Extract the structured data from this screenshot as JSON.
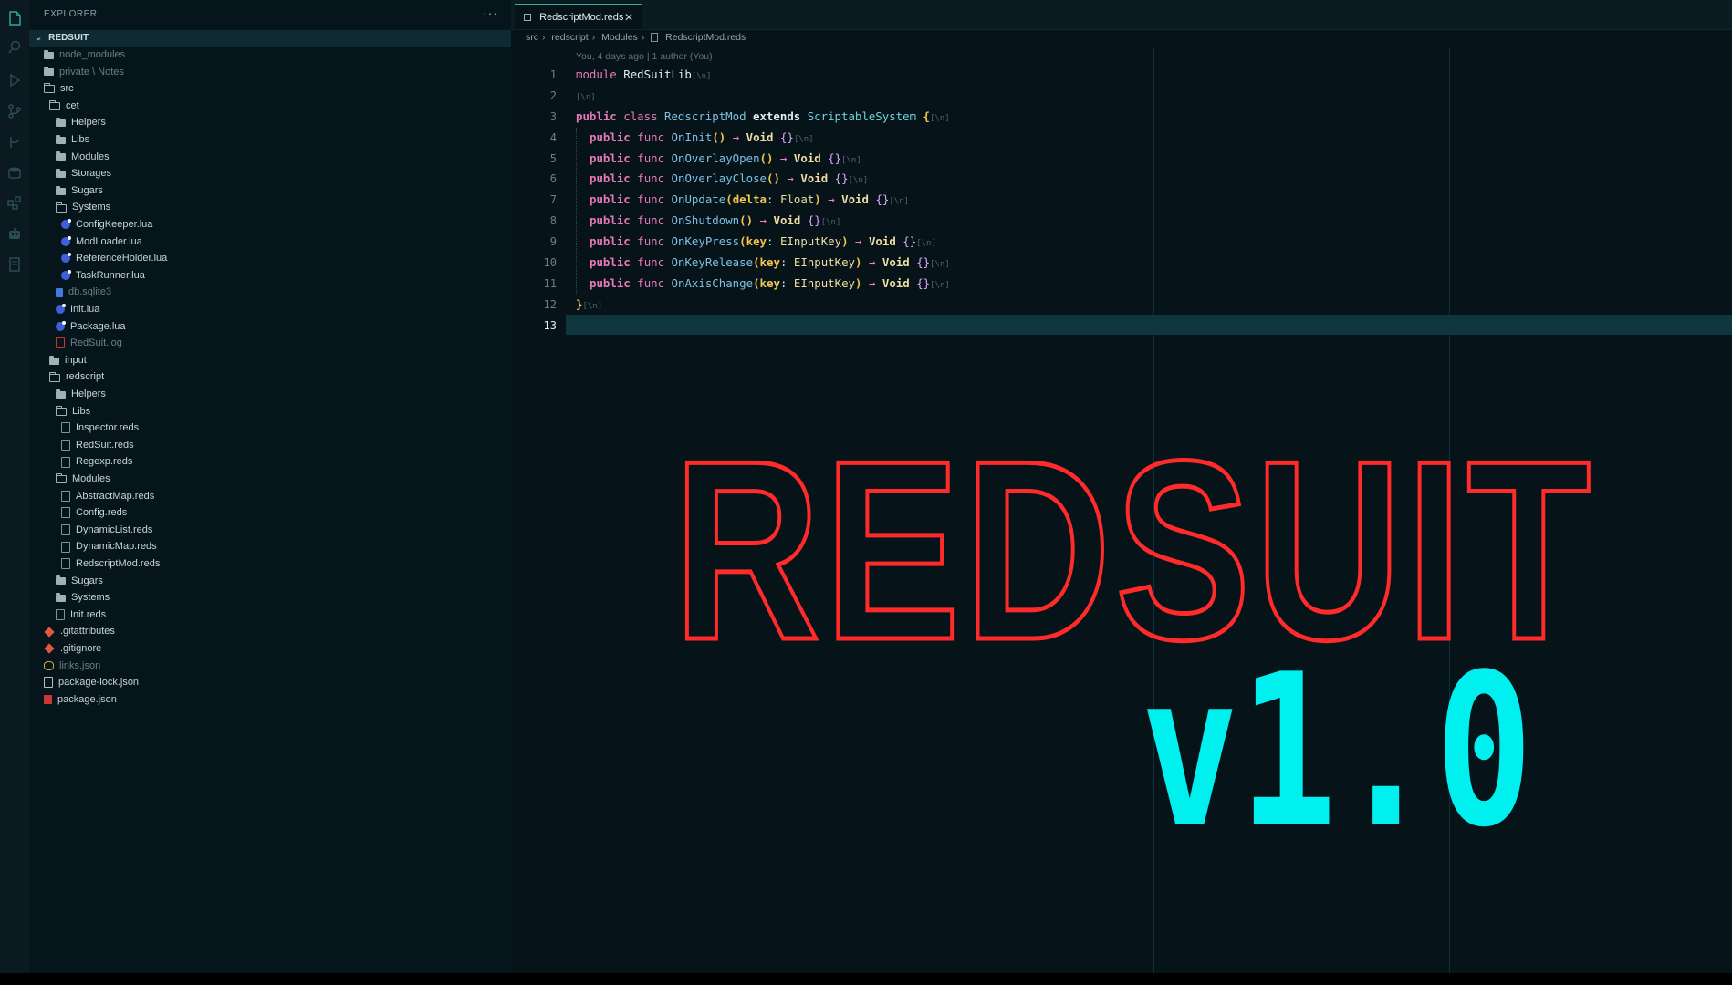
{
  "explorer": {
    "title": "EXPLORER",
    "more": "···",
    "project": "REDSUIT"
  },
  "tree": [
    {
      "label": "node_modules",
      "icon": "folder-closed",
      "depth": 0,
      "dim": true
    },
    {
      "label": "private \\ Notes",
      "icon": "folder-closed",
      "depth": 0,
      "dim": true
    },
    {
      "label": "src",
      "icon": "folder",
      "depth": 0
    },
    {
      "label": "cet",
      "icon": "folder",
      "depth": 1
    },
    {
      "label": "Helpers",
      "icon": "folder-closed",
      "depth": 2
    },
    {
      "label": "Libs",
      "icon": "folder-closed",
      "depth": 2
    },
    {
      "label": "Modules",
      "icon": "folder-closed",
      "depth": 2
    },
    {
      "label": "Storages",
      "icon": "folder-closed",
      "depth": 2
    },
    {
      "label": "Sugars",
      "icon": "folder-closed",
      "depth": 2
    },
    {
      "label": "Systems",
      "icon": "folder",
      "depth": 2
    },
    {
      "label": "ConfigKeeper.lua",
      "icon": "lua",
      "depth": 3
    },
    {
      "label": "ModLoader.lua",
      "icon": "lua",
      "depth": 3
    },
    {
      "label": "ReferenceHolder.lua",
      "icon": "lua",
      "depth": 3
    },
    {
      "label": "TaskRunner.lua",
      "icon": "lua",
      "depth": 3
    },
    {
      "label": "db.sqlite3",
      "icon": "db",
      "depth": 2,
      "dim": true
    },
    {
      "label": "Init.lua",
      "icon": "lua",
      "depth": 2
    },
    {
      "label": "Package.lua",
      "icon": "lua",
      "depth": 2
    },
    {
      "label": "RedSuit.log",
      "icon": "log",
      "depth": 2,
      "dim": true
    },
    {
      "label": "input",
      "icon": "folder-closed",
      "depth": 1
    },
    {
      "label": "redscript",
      "icon": "folder",
      "depth": 1
    },
    {
      "label": "Helpers",
      "icon": "folder-closed",
      "depth": 2
    },
    {
      "label": "Libs",
      "icon": "folder",
      "depth": 2
    },
    {
      "label": "Inspector.reds",
      "icon": "file",
      "depth": 3
    },
    {
      "label": "RedSuit.reds",
      "icon": "file",
      "depth": 3
    },
    {
      "label": "Regexp.reds",
      "icon": "file",
      "depth": 3
    },
    {
      "label": "Modules",
      "icon": "folder",
      "depth": 2
    },
    {
      "label": "AbstractMap.reds",
      "icon": "file",
      "depth": 3
    },
    {
      "label": "Config.reds",
      "icon": "file",
      "depth": 3
    },
    {
      "label": "DynamicList.reds",
      "icon": "file",
      "depth": 3
    },
    {
      "label": "DynamicMap.reds",
      "icon": "file",
      "depth": 3
    },
    {
      "label": "RedscriptMod.reds",
      "icon": "file",
      "depth": 3
    },
    {
      "label": "Sugars",
      "icon": "folder-closed",
      "depth": 2
    },
    {
      "label": "Systems",
      "icon": "folder-closed",
      "depth": 2
    },
    {
      "label": "Init.reds",
      "icon": "file",
      "depth": 2
    },
    {
      "label": ".gitattributes",
      "icon": "git",
      "depth": 0
    },
    {
      "label": ".gitignore",
      "icon": "git",
      "depth": 0
    },
    {
      "label": "links.json",
      "icon": "links",
      "depth": 0,
      "dim": true
    },
    {
      "label": "package-lock.json",
      "icon": "json",
      "depth": 0
    },
    {
      "label": "package.json",
      "icon": "pkg",
      "depth": 0
    }
  ],
  "tab": {
    "label": "RedscriptMod.reds",
    "close": "✕"
  },
  "breadcrumb": [
    "src",
    "redscript",
    "Modules",
    "RedscriptMod.reds"
  ],
  "blame": "You, 4 days ago | 1 author (You)",
  "line_numbers": [
    "1",
    "2",
    "3",
    "4",
    "5",
    "6",
    "7",
    "8",
    "9",
    "10",
    "11",
    "12",
    "13"
  ],
  "code": {
    "l1": {
      "kw": "module",
      "name": "RedSuitLib",
      "ws": "[\\n]"
    },
    "l2": {
      "ws": "[\\n]"
    },
    "l3": {
      "kw1": "public",
      "kw2": "class",
      "name": "RedscriptMod",
      "kw3": "extends",
      "base": "ScriptableSystem",
      "brace": "{",
      "ws": "[\\n]"
    },
    "methods": [
      {
        "kw1": "public",
        "kw2": "func",
        "name": "OnInit",
        "params": "()",
        "arrow": "→",
        "ret": "Void",
        "body": "{}",
        "ws": "[\\n]"
      },
      {
        "kw1": "public",
        "kw2": "func",
        "name": "OnOverlayOpen",
        "params": "()",
        "arrow": "→",
        "ret": "Void",
        "body": "{}",
        "ws": "[\\n]"
      },
      {
        "kw1": "public",
        "kw2": "func",
        "name": "OnOverlayClose",
        "params": "()",
        "arrow": "→",
        "ret": "Void",
        "body": "{}",
        "ws": "[\\n]"
      },
      {
        "kw1": "public",
        "kw2": "func",
        "name": "OnUpdate",
        "pname": "delta",
        "ptype": "Float",
        "arrow": "→",
        "ret": "Void",
        "body": "{}",
        "ws": "[\\n]"
      },
      {
        "kw1": "public",
        "kw2": "func",
        "name": "OnShutdown",
        "params": "()",
        "arrow": "→",
        "ret": "Void",
        "body": "{}",
        "ws": "[\\n]"
      },
      {
        "kw1": "public",
        "kw2": "func",
        "name": "OnKeyPress",
        "pname": "key",
        "ptype": "EInputKey",
        "arrow": "→",
        "ret": "Void",
        "body": "{}",
        "ws": "[\\n]"
      },
      {
        "kw1": "public",
        "kw2": "func",
        "name": "OnKeyRelease",
        "pname": "key",
        "ptype": "EInputKey",
        "arrow": "→",
        "ret": "Void",
        "body": "{}",
        "ws": "[\\n]"
      },
      {
        "kw1": "public",
        "kw2": "func",
        "name": "OnAxisChange",
        "pname": "key",
        "ptype": "EInputKey",
        "arrow": "→",
        "ret": "Void",
        "body": "{}",
        "ws": "[\\n]"
      }
    ],
    "l12": {
      "brace": "}",
      "ws": "[\\n]"
    }
  },
  "overlay": {
    "title": "REDSUIT",
    "version": "v1.0",
    "title_color": "#ff2a2a",
    "version_color": "#00f0f0"
  },
  "icons": [
    "files-icon",
    "search-icon",
    "run-debug-icon",
    "source-control-icon",
    "branch-icon",
    "database-icon",
    "extensions-icon",
    "robot-icon",
    "notebook-icon"
  ]
}
